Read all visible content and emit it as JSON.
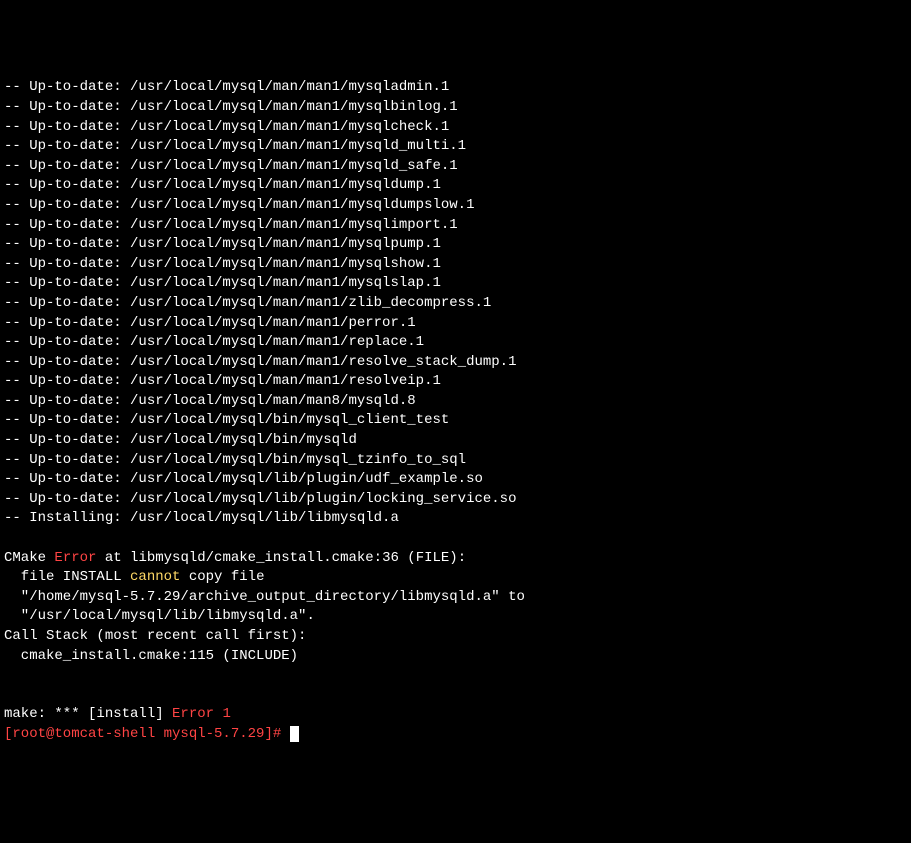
{
  "lines": [
    {
      "type": "plain",
      "text": "-- Up-to-date: /usr/local/mysql/man/man1/mysqladmin.1"
    },
    {
      "type": "plain",
      "text": "-- Up-to-date: /usr/local/mysql/man/man1/mysqlbinlog.1"
    },
    {
      "type": "plain",
      "text": "-- Up-to-date: /usr/local/mysql/man/man1/mysqlcheck.1"
    },
    {
      "type": "plain",
      "text": "-- Up-to-date: /usr/local/mysql/man/man1/mysqld_multi.1"
    },
    {
      "type": "plain",
      "text": "-- Up-to-date: /usr/local/mysql/man/man1/mysqld_safe.1"
    },
    {
      "type": "plain",
      "text": "-- Up-to-date: /usr/local/mysql/man/man1/mysqldump.1"
    },
    {
      "type": "plain",
      "text": "-- Up-to-date: /usr/local/mysql/man/man1/mysqldumpslow.1"
    },
    {
      "type": "plain",
      "text": "-- Up-to-date: /usr/local/mysql/man/man1/mysqlimport.1"
    },
    {
      "type": "plain",
      "text": "-- Up-to-date: /usr/local/mysql/man/man1/mysqlpump.1"
    },
    {
      "type": "plain",
      "text": "-- Up-to-date: /usr/local/mysql/man/man1/mysqlshow.1"
    },
    {
      "type": "plain",
      "text": "-- Up-to-date: /usr/local/mysql/man/man1/mysqlslap.1"
    },
    {
      "type": "plain",
      "text": "-- Up-to-date: /usr/local/mysql/man/man1/zlib_decompress.1"
    },
    {
      "type": "plain",
      "text": "-- Up-to-date: /usr/local/mysql/man/man1/perror.1"
    },
    {
      "type": "plain",
      "text": "-- Up-to-date: /usr/local/mysql/man/man1/replace.1"
    },
    {
      "type": "plain",
      "text": "-- Up-to-date: /usr/local/mysql/man/man1/resolve_stack_dump.1"
    },
    {
      "type": "plain",
      "text": "-- Up-to-date: /usr/local/mysql/man/man1/resolveip.1"
    },
    {
      "type": "plain",
      "text": "-- Up-to-date: /usr/local/mysql/man/man8/mysqld.8"
    },
    {
      "type": "plain",
      "text": "-- Up-to-date: /usr/local/mysql/bin/mysql_client_test"
    },
    {
      "type": "plain",
      "text": "-- Up-to-date: /usr/local/mysql/bin/mysqld"
    },
    {
      "type": "plain",
      "text": "-- Up-to-date: /usr/local/mysql/bin/mysql_tzinfo_to_sql"
    },
    {
      "type": "plain",
      "text": "-- Up-to-date: /usr/local/mysql/lib/plugin/udf_example.so"
    },
    {
      "type": "plain",
      "text": "-- Up-to-date: /usr/local/mysql/lib/plugin/locking_service.so"
    },
    {
      "type": "plain",
      "text": "-- Installing: /usr/local/mysql/lib/libmysqld.a"
    },
    {
      "type": "blank",
      "text": ""
    },
    {
      "type": "cmake_error",
      "pre": "CMake ",
      "error": "Error",
      "post": " at libmysqld/cmake_install.cmake:36 (FILE):"
    },
    {
      "type": "cannot_line",
      "pre": "  file INSTALL ",
      "cannot": "cannot",
      "post": " copy file"
    },
    {
      "type": "plain",
      "text": "  \"/home/mysql-5.7.29/archive_output_directory/libmysqld.a\" to"
    },
    {
      "type": "plain",
      "text": "  \"/usr/local/mysql/lib/libmysqld.a\"."
    },
    {
      "type": "plain",
      "text": "Call Stack (most recent call first):"
    },
    {
      "type": "plain",
      "text": "  cmake_install.cmake:115 (INCLUDE)"
    },
    {
      "type": "blank",
      "text": ""
    },
    {
      "type": "blank",
      "text": ""
    },
    {
      "type": "make_error",
      "pre": "make: *** [install] ",
      "error": "Error 1"
    },
    {
      "type": "prompt",
      "prompt": "[root@tomcat-shell mysql-5.7.29]#",
      "input": " "
    }
  ]
}
